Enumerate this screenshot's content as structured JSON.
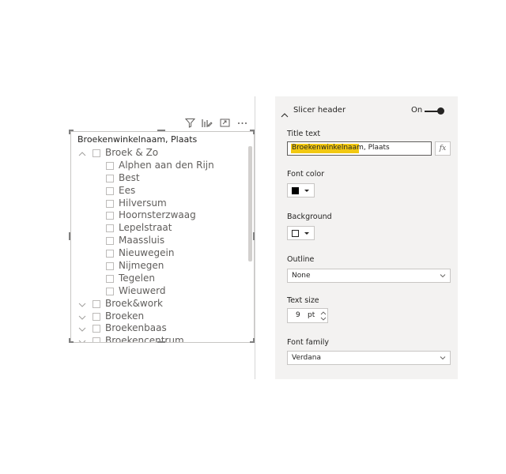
{
  "visual_toolbar": {
    "icons": [
      "filter-icon",
      "focus-mode-icon",
      "expand-icon",
      "more-options-icon"
    ]
  },
  "slicer": {
    "title": "Broekenwinkelnaam, Plaats",
    "items": [
      {
        "level": "parent",
        "label": "Broek & Zo",
        "expanded": true
      },
      {
        "level": "child",
        "label": "Alphen aan den Rijn"
      },
      {
        "level": "child",
        "label": "Best"
      },
      {
        "level": "child",
        "label": "Ees"
      },
      {
        "level": "child",
        "label": "Hilversum"
      },
      {
        "level": "child",
        "label": "Hoornsterzwaag"
      },
      {
        "level": "child",
        "label": "Lepelstraat"
      },
      {
        "level": "child",
        "label": "Maassluis"
      },
      {
        "level": "child",
        "label": "Nieuwegein"
      },
      {
        "level": "child",
        "label": "Nijmegen"
      },
      {
        "level": "child",
        "label": "Tegelen"
      },
      {
        "level": "child",
        "label": "Wieuwerd"
      },
      {
        "level": "parent",
        "label": "Broek&work",
        "expanded": false
      },
      {
        "level": "parent",
        "label": "Broeken",
        "expanded": false
      },
      {
        "level": "parent",
        "label": "Broekenbaas",
        "expanded": false
      },
      {
        "level": "parent",
        "label": "Broekencentrum",
        "expanded": false
      }
    ]
  },
  "format_pane": {
    "section_title": "Slicer header",
    "toggle_label": "On",
    "toggle_on": true,
    "title_text_label": "Title text",
    "title_text_value": "Broekenwinkelnaam, Plaats",
    "fx_label": "fx",
    "font_color_label": "Font color",
    "font_color": "#000000",
    "background_label": "Background",
    "background_color": "#ffffff",
    "outline_label": "Outline",
    "outline_value": "None",
    "text_size_label": "Text size",
    "text_size_value": "9",
    "text_size_unit": "pt",
    "font_family_label": "Font family",
    "font_family_value": "Verdana"
  },
  "colors": {
    "accent_highlight": "#f2c811",
    "pane_background": "#f3f2f1",
    "text": "#252423"
  }
}
